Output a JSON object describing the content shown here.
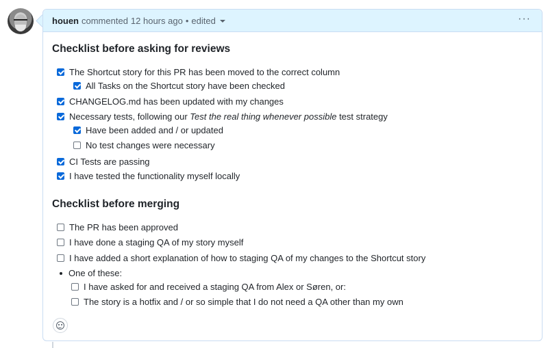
{
  "comment": {
    "author": "houen",
    "action": "commented",
    "time": "12 hours ago",
    "separator": "•",
    "edited": "edited",
    "menu_icon": "kebab-horizontal-icon"
  },
  "sections": [
    {
      "title": "Checklist before asking for reviews",
      "items": [
        {
          "text": "The Shortcut story for this PR has been moved to the correct column",
          "checked": true
        },
        {
          "text": "All Tasks on the Shortcut story have been checked",
          "checked": true
        },
        {
          "text": "CHANGELOG.md has been updated with my changes",
          "checked": true
        },
        {
          "text_before": "Necessary tests, following our ",
          "text_em": "Test the real thing whenever possible",
          "text_after": " test strategy",
          "checked": true
        },
        {
          "text": "Have been added and / or updated",
          "checked": true
        },
        {
          "text": "No test changes were necessary",
          "checked": false
        },
        {
          "text": "CI Tests are passing",
          "checked": true
        },
        {
          "text": "I have tested the functionality myself locally",
          "checked": true
        }
      ]
    },
    {
      "title": "Checklist before merging",
      "items": [
        {
          "text": "The PR has been approved",
          "checked": false
        },
        {
          "text": "I have done a staging QA of my story myself",
          "checked": false
        },
        {
          "text": "I have added a short explanation of how to staging QA of my changes to the Shortcut story",
          "checked": false
        },
        {
          "text": "One of these:",
          "bullet": true
        },
        {
          "text": "I have asked for and received a staging QA from Alex or Søren, or:",
          "checked": false
        },
        {
          "text": "The story is a hotfix and / or so simple that I do not need a QA other than my own",
          "checked": false
        }
      ]
    }
  ],
  "reaction_icon": "smiley-icon"
}
